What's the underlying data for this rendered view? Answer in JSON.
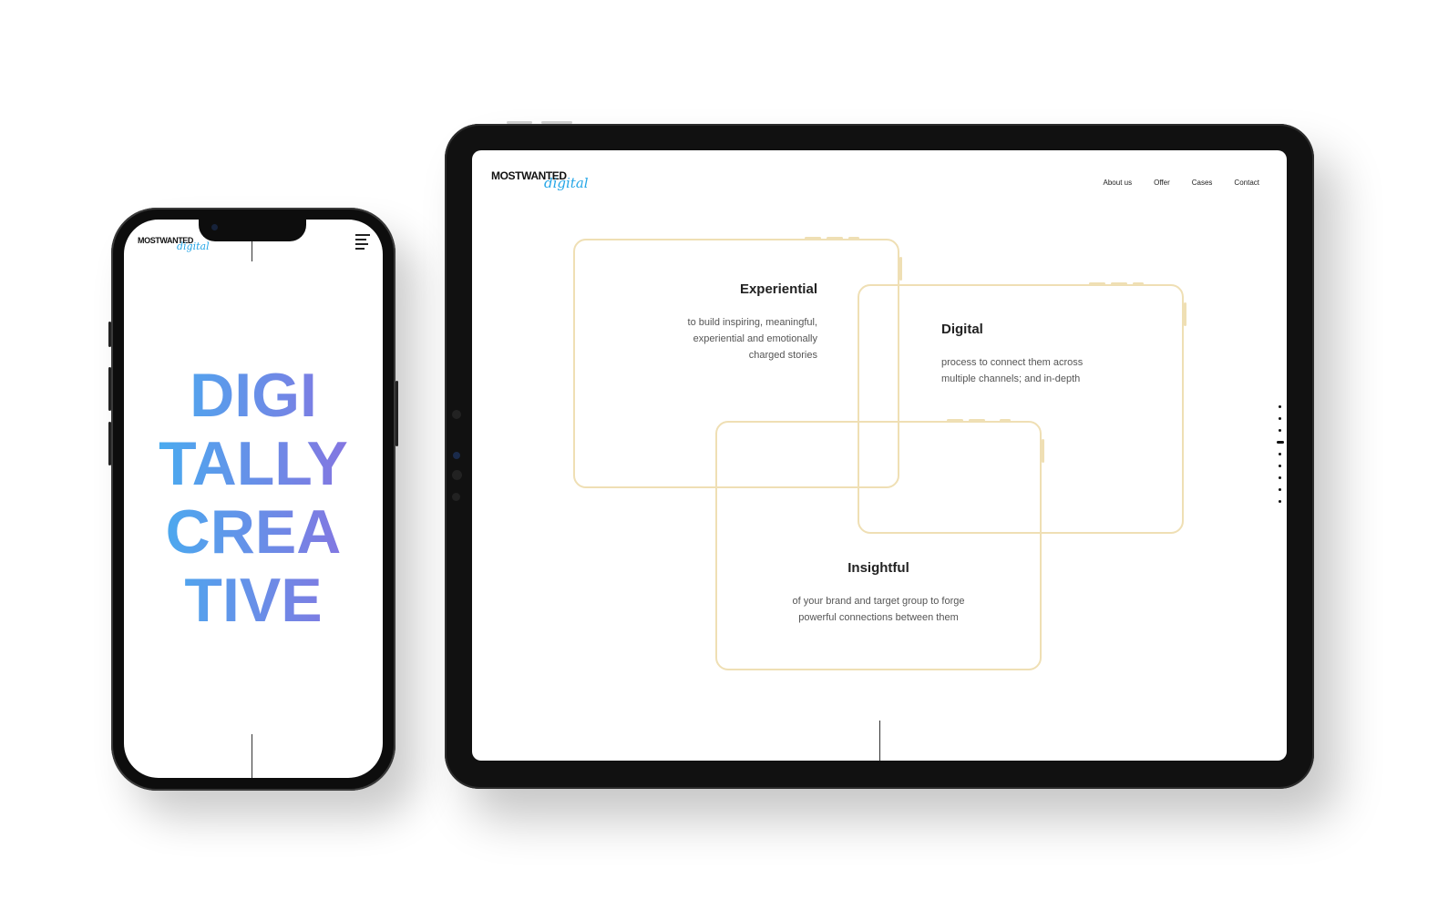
{
  "brand": {
    "logo_main": "MOSTWANTED",
    "logo_script": "digital",
    "script_color": "#27a7e7"
  },
  "phone": {
    "menu_icon": "hamburger-menu-icon",
    "hero_lines": [
      "DIGI",
      "TALLY",
      "CREA",
      "TIVE"
    ],
    "hero_gradient": [
      "#3fb4f2",
      "#8f6cde"
    ]
  },
  "tablet": {
    "nav": [
      {
        "label": "About us"
      },
      {
        "label": "Offer"
      },
      {
        "label": "Cases"
      },
      {
        "label": "Contact"
      }
    ],
    "card_color": "#efdfb4",
    "cards": [
      {
        "title": "Experiential",
        "lines": [
          "to build inspiring, meaningful,",
          "experiential and emotionally",
          "charged stories"
        ]
      },
      {
        "title": "Digital",
        "lines": [
          "process to connect them across",
          "multiple channels; and in-depth"
        ]
      },
      {
        "title": "Insightful",
        "lines": [
          "of your brand and target group to forge",
          "powerful connections between them"
        ]
      }
    ],
    "pager": {
      "total": 9,
      "active_index": 3
    }
  }
}
